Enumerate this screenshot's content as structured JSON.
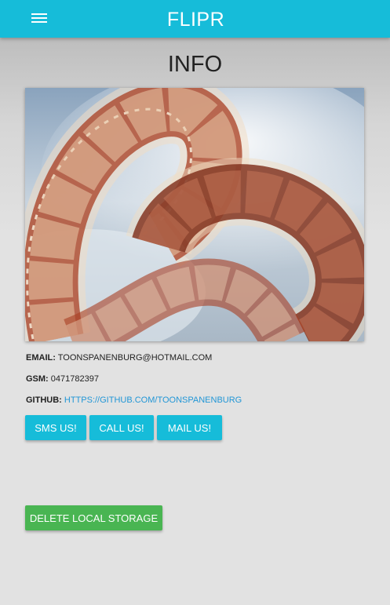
{
  "appbar": {
    "title": "FLIPR",
    "menu_icon": "hamburger-menu-icon"
  },
  "page": {
    "title": "INFO"
  },
  "hero_image": {
    "subject": "film-reel-photo"
  },
  "contact": {
    "email_label": "EMAIL:",
    "email_value": "TOONSPANENBURG@HOTMAIL.COM",
    "gsm_label": "GSM:",
    "gsm_value": "0471782397",
    "github_label": "GITHUB:",
    "github_value": "HTTPS://GITHUB.COM/TOONSPANENBURG"
  },
  "actions": {
    "sms_label": "SMS US!",
    "call_label": "CALL US!",
    "mail_label": "MAIL US!",
    "delete_label": "DELETE LOCAL STORAGE"
  },
  "colors": {
    "primary": "#16bcd9",
    "danger_action": "#49b552",
    "link": "#2196d6"
  }
}
